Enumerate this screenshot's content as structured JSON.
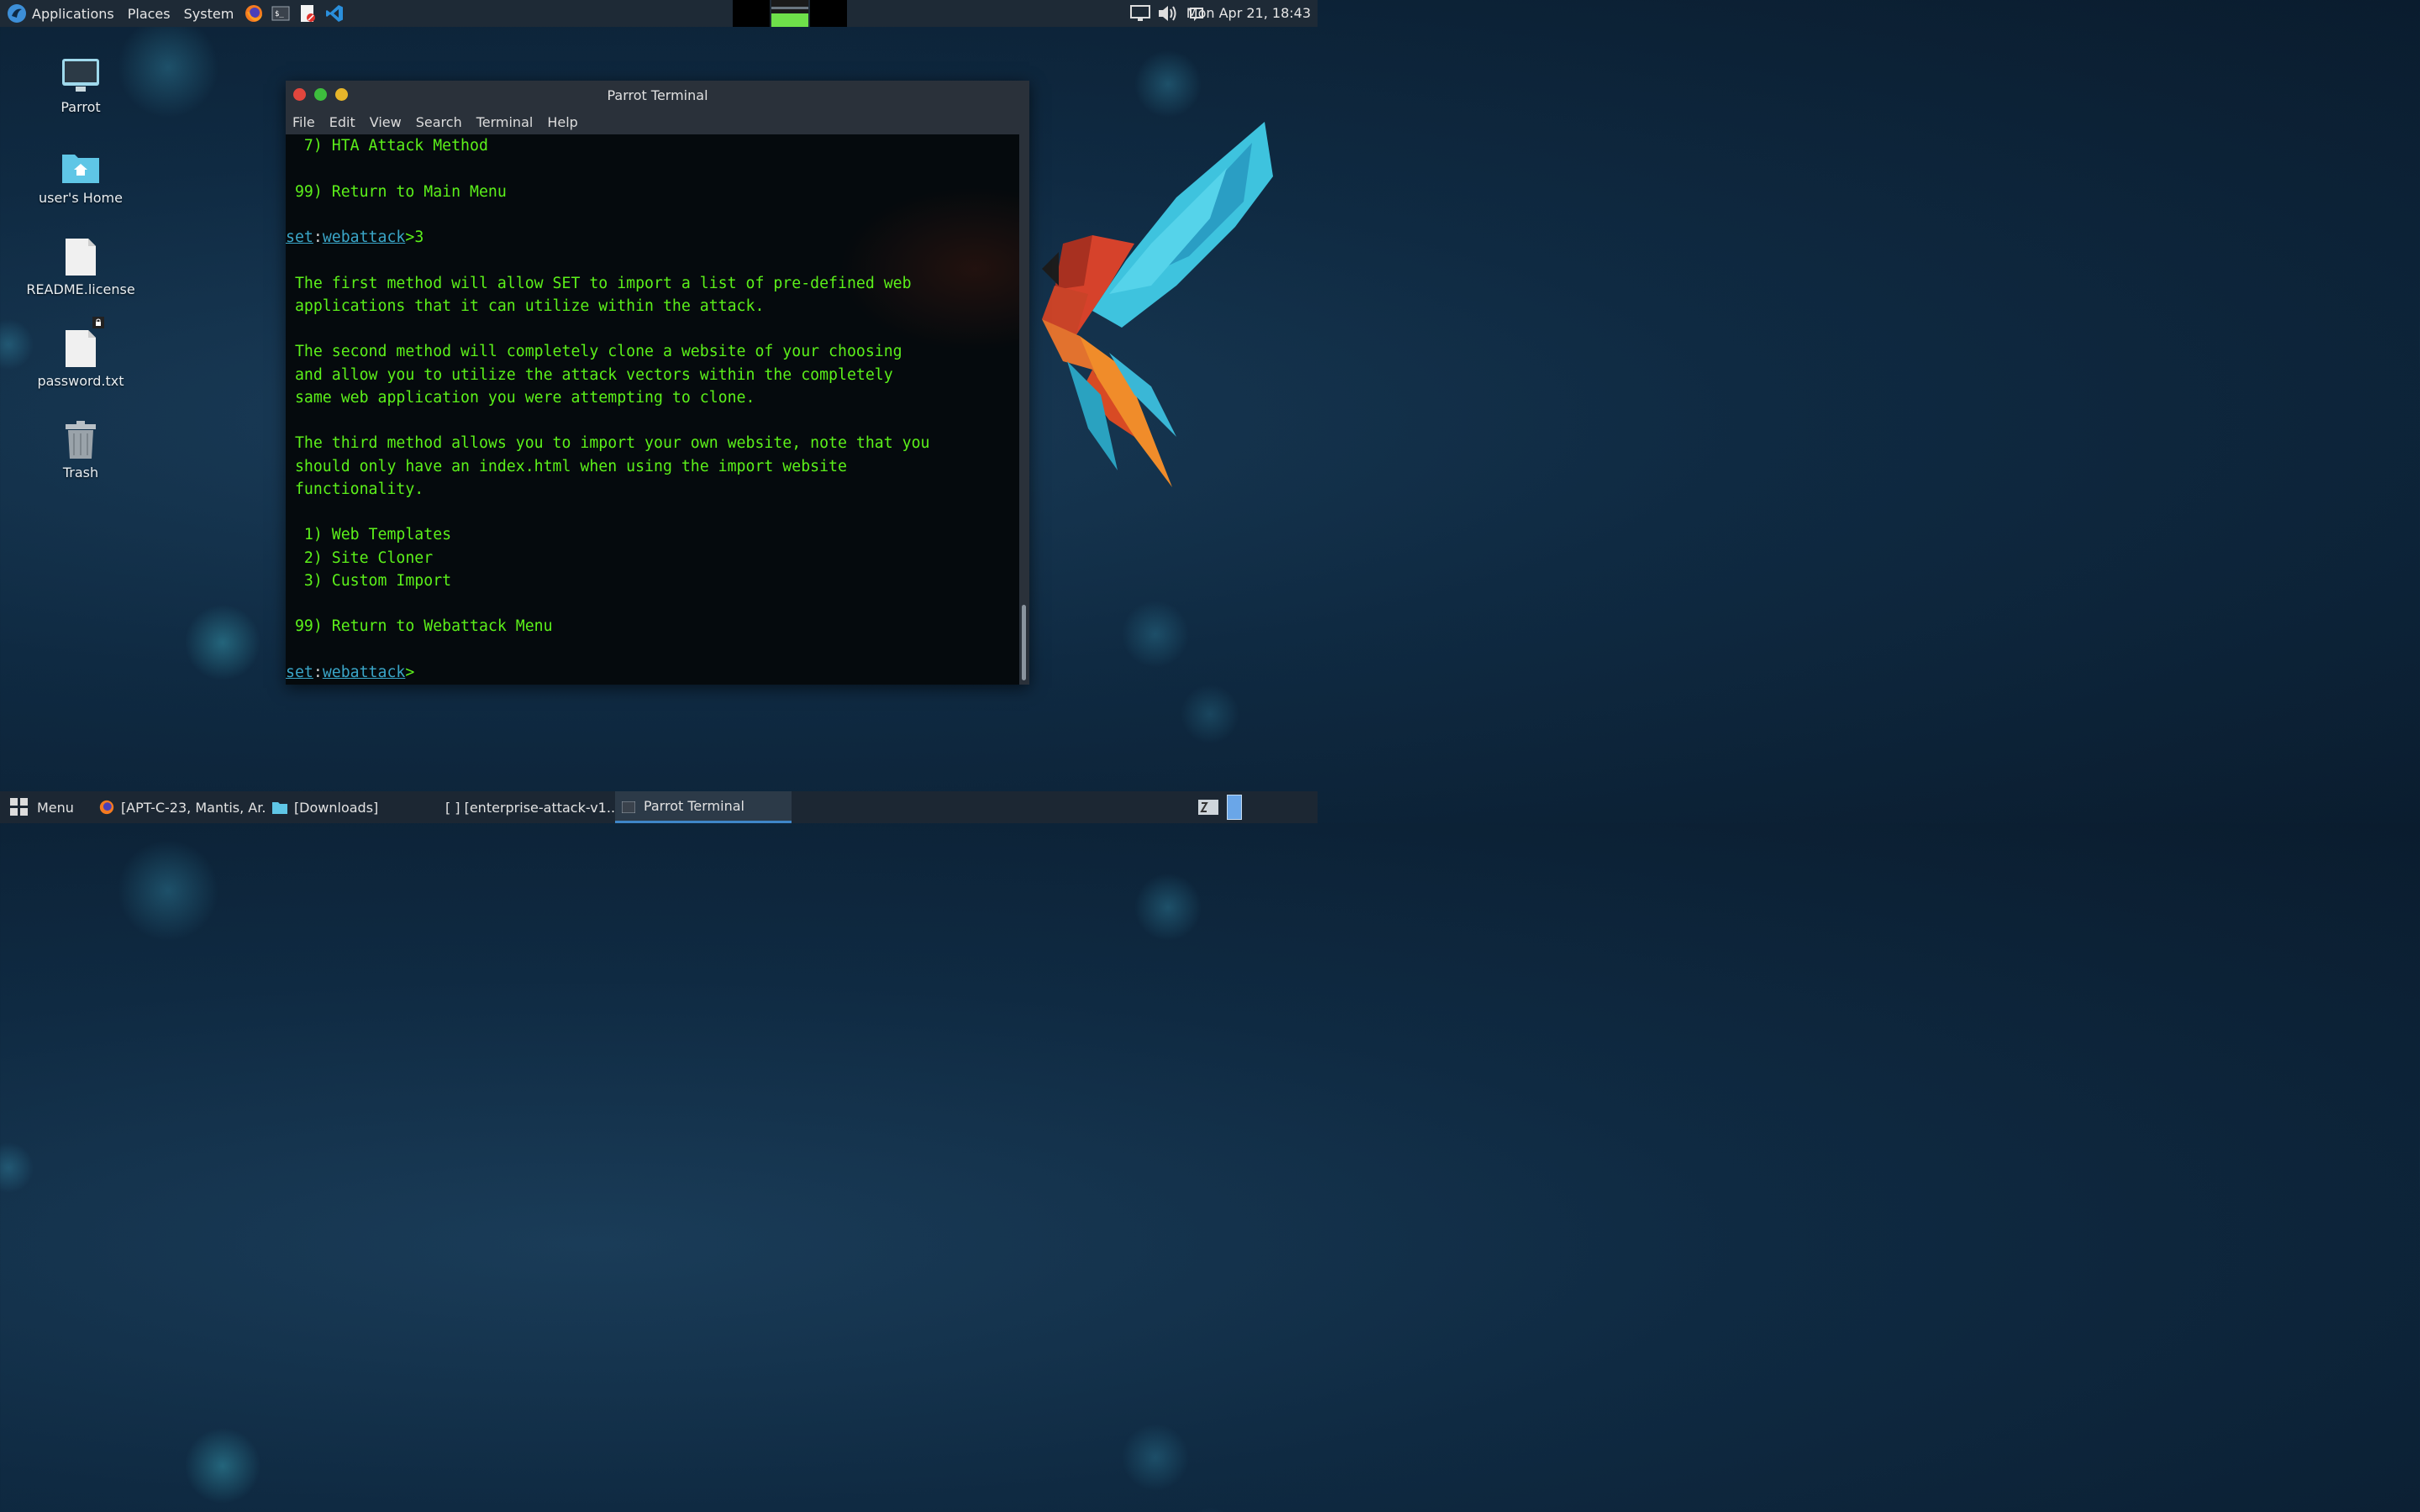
{
  "topbar": {
    "menus": [
      "Applications",
      "Places",
      "System"
    ],
    "launchers": [
      "firefox-icon",
      "terminal-icon",
      "text-editor-icon",
      "vscode-icon"
    ],
    "clock": "Mon Apr 21, 18:43"
  },
  "desktop": {
    "icons": [
      {
        "label": "Parrot"
      },
      {
        "label": "user's Home"
      },
      {
        "label": "README.license"
      },
      {
        "label": "password.txt"
      },
      {
        "label": "Trash"
      }
    ]
  },
  "window": {
    "title": "Parrot Terminal",
    "menu": [
      "File",
      "Edit",
      "View",
      "Search",
      "Terminal",
      "Help"
    ]
  },
  "terminal": {
    "lines": [
      "  7) HTA Attack Method",
      "",
      " 99) Return to Main Menu",
      "",
      "PROMPT:3",
      "",
      " The first method will allow SET to import a list of pre-defined web",
      " applications that it can utilize within the attack.",
      "",
      " The second method will completely clone a website of your choosing",
      " and allow you to utilize the attack vectors within the completely",
      " same web application you were attempting to clone.",
      "",
      " The third method allows you to import your own website, note that you",
      " should only have an index.html when using the import website",
      " functionality.",
      "",
      "  1) Web Templates",
      "  2) Site Cloner",
      "  3) Custom Import",
      "",
      " 99) Return to Webattack Menu",
      "",
      "PROMPT:"
    ],
    "prompt_set": "set",
    "prompt_colon": ":",
    "prompt_module": "webattack",
    "prompt_gt": ">"
  },
  "taskbar": {
    "menu_label": "Menu",
    "tasks": [
      {
        "label": "[APT-C-23, Mantis, Ar...",
        "icon": "firefox-icon"
      },
      {
        "label": "[Downloads]",
        "icon": "folder-icon"
      },
      {
        "label": "[ ] [enterprise-attack-v1...",
        "icon": "none"
      },
      {
        "label": "Parrot Terminal",
        "icon": "terminal-icon"
      }
    ]
  },
  "colors": {
    "terminal_text": "#5cf01a",
    "prompt_accent": "#3aa6c8",
    "panel_bg": "#1e2a36"
  }
}
